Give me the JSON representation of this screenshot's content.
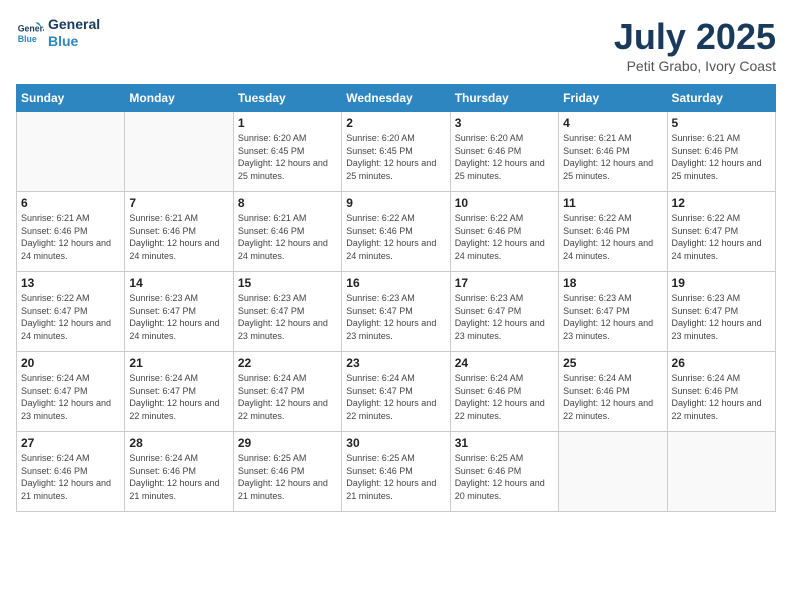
{
  "header": {
    "logo_line1": "General",
    "logo_line2": "Blue",
    "title": "July 2025",
    "subtitle": "Petit Grabo, Ivory Coast"
  },
  "calendar": {
    "weekdays": [
      "Sunday",
      "Monday",
      "Tuesday",
      "Wednesday",
      "Thursday",
      "Friday",
      "Saturday"
    ],
    "weeks": [
      [
        {
          "day": "",
          "info": ""
        },
        {
          "day": "",
          "info": ""
        },
        {
          "day": "1",
          "info": "Sunrise: 6:20 AM\nSunset: 6:45 PM\nDaylight: 12 hours and 25 minutes."
        },
        {
          "day": "2",
          "info": "Sunrise: 6:20 AM\nSunset: 6:45 PM\nDaylight: 12 hours and 25 minutes."
        },
        {
          "day": "3",
          "info": "Sunrise: 6:20 AM\nSunset: 6:46 PM\nDaylight: 12 hours and 25 minutes."
        },
        {
          "day": "4",
          "info": "Sunrise: 6:21 AM\nSunset: 6:46 PM\nDaylight: 12 hours and 25 minutes."
        },
        {
          "day": "5",
          "info": "Sunrise: 6:21 AM\nSunset: 6:46 PM\nDaylight: 12 hours and 25 minutes."
        }
      ],
      [
        {
          "day": "6",
          "info": "Sunrise: 6:21 AM\nSunset: 6:46 PM\nDaylight: 12 hours and 24 minutes."
        },
        {
          "day": "7",
          "info": "Sunrise: 6:21 AM\nSunset: 6:46 PM\nDaylight: 12 hours and 24 minutes."
        },
        {
          "day": "8",
          "info": "Sunrise: 6:21 AM\nSunset: 6:46 PM\nDaylight: 12 hours and 24 minutes."
        },
        {
          "day": "9",
          "info": "Sunrise: 6:22 AM\nSunset: 6:46 PM\nDaylight: 12 hours and 24 minutes."
        },
        {
          "day": "10",
          "info": "Sunrise: 6:22 AM\nSunset: 6:46 PM\nDaylight: 12 hours and 24 minutes."
        },
        {
          "day": "11",
          "info": "Sunrise: 6:22 AM\nSunset: 6:46 PM\nDaylight: 12 hours and 24 minutes."
        },
        {
          "day": "12",
          "info": "Sunrise: 6:22 AM\nSunset: 6:47 PM\nDaylight: 12 hours and 24 minutes."
        }
      ],
      [
        {
          "day": "13",
          "info": "Sunrise: 6:22 AM\nSunset: 6:47 PM\nDaylight: 12 hours and 24 minutes."
        },
        {
          "day": "14",
          "info": "Sunrise: 6:23 AM\nSunset: 6:47 PM\nDaylight: 12 hours and 24 minutes."
        },
        {
          "day": "15",
          "info": "Sunrise: 6:23 AM\nSunset: 6:47 PM\nDaylight: 12 hours and 23 minutes."
        },
        {
          "day": "16",
          "info": "Sunrise: 6:23 AM\nSunset: 6:47 PM\nDaylight: 12 hours and 23 minutes."
        },
        {
          "day": "17",
          "info": "Sunrise: 6:23 AM\nSunset: 6:47 PM\nDaylight: 12 hours and 23 minutes."
        },
        {
          "day": "18",
          "info": "Sunrise: 6:23 AM\nSunset: 6:47 PM\nDaylight: 12 hours and 23 minutes."
        },
        {
          "day": "19",
          "info": "Sunrise: 6:23 AM\nSunset: 6:47 PM\nDaylight: 12 hours and 23 minutes."
        }
      ],
      [
        {
          "day": "20",
          "info": "Sunrise: 6:24 AM\nSunset: 6:47 PM\nDaylight: 12 hours and 23 minutes."
        },
        {
          "day": "21",
          "info": "Sunrise: 6:24 AM\nSunset: 6:47 PM\nDaylight: 12 hours and 22 minutes."
        },
        {
          "day": "22",
          "info": "Sunrise: 6:24 AM\nSunset: 6:47 PM\nDaylight: 12 hours and 22 minutes."
        },
        {
          "day": "23",
          "info": "Sunrise: 6:24 AM\nSunset: 6:47 PM\nDaylight: 12 hours and 22 minutes."
        },
        {
          "day": "24",
          "info": "Sunrise: 6:24 AM\nSunset: 6:46 PM\nDaylight: 12 hours and 22 minutes."
        },
        {
          "day": "25",
          "info": "Sunrise: 6:24 AM\nSunset: 6:46 PM\nDaylight: 12 hours and 22 minutes."
        },
        {
          "day": "26",
          "info": "Sunrise: 6:24 AM\nSunset: 6:46 PM\nDaylight: 12 hours and 22 minutes."
        }
      ],
      [
        {
          "day": "27",
          "info": "Sunrise: 6:24 AM\nSunset: 6:46 PM\nDaylight: 12 hours and 21 minutes."
        },
        {
          "day": "28",
          "info": "Sunrise: 6:24 AM\nSunset: 6:46 PM\nDaylight: 12 hours and 21 minutes."
        },
        {
          "day": "29",
          "info": "Sunrise: 6:25 AM\nSunset: 6:46 PM\nDaylight: 12 hours and 21 minutes."
        },
        {
          "day": "30",
          "info": "Sunrise: 6:25 AM\nSunset: 6:46 PM\nDaylight: 12 hours and 21 minutes."
        },
        {
          "day": "31",
          "info": "Sunrise: 6:25 AM\nSunset: 6:46 PM\nDaylight: 12 hours and 20 minutes."
        },
        {
          "day": "",
          "info": ""
        },
        {
          "day": "",
          "info": ""
        }
      ]
    ]
  }
}
